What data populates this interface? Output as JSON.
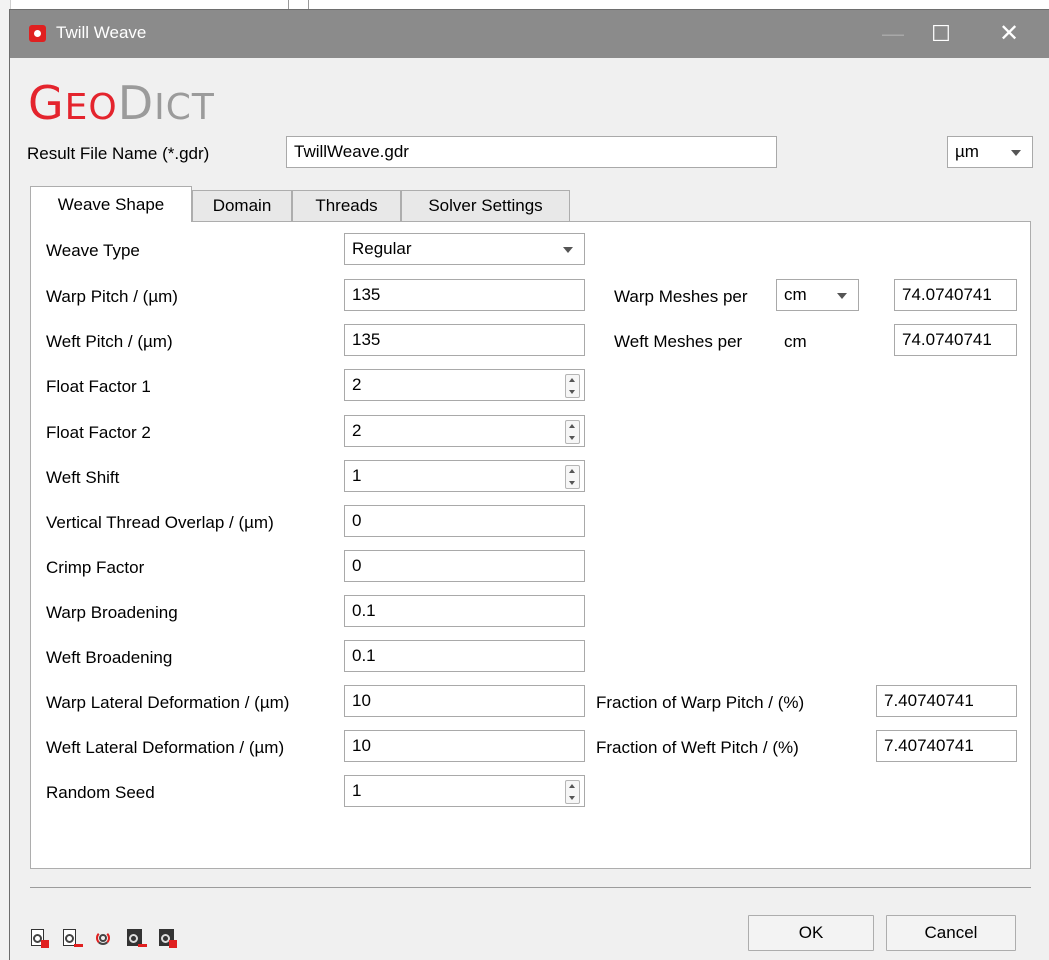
{
  "window": {
    "title": "Twill Weave"
  },
  "logo": {
    "geo_g": "G",
    "geo_rest": "EO",
    "dict_d": "D",
    "dict_rest": "ICT"
  },
  "result_file": {
    "label": "Result File Name (*.gdr)",
    "value": "TwillWeave.gdr"
  },
  "unit_select": {
    "value": "µm"
  },
  "tabs": [
    {
      "label": "Weave Shape",
      "active": true
    },
    {
      "label": "Domain",
      "active": false
    },
    {
      "label": "Threads",
      "active": false
    },
    {
      "label": "Solver Settings",
      "active": false
    }
  ],
  "form": {
    "weave_type": {
      "label": "Weave Type",
      "value": "Regular"
    },
    "warp_pitch": {
      "label": "Warp Pitch / (µm)",
      "value": "135"
    },
    "weft_pitch": {
      "label": "Weft Pitch / (µm)",
      "value": "135"
    },
    "float_factor_1": {
      "label": "Float Factor 1",
      "value": "2"
    },
    "float_factor_2": {
      "label": "Float Factor 2",
      "value": "2"
    },
    "weft_shift": {
      "label": "Weft Shift",
      "value": "1"
    },
    "vertical_overlap": {
      "label": "Vertical Thread Overlap / (µm)",
      "value": "0"
    },
    "crimp_factor": {
      "label": "Crimp Factor",
      "value": "0"
    },
    "warp_broadening": {
      "label": "Warp Broadening",
      "value": "0.1"
    },
    "weft_broadening": {
      "label": "Weft Broadening",
      "value": "0.1"
    },
    "warp_lateral": {
      "label": "Warp Lateral Deformation / (µm)",
      "value": "10"
    },
    "weft_lateral": {
      "label": "Weft Lateral Deformation / (µm)",
      "value": "10"
    },
    "random_seed": {
      "label": "Random Seed",
      "value": "1"
    },
    "warp_meshes": {
      "label": "Warp Meshes per",
      "unit": "cm",
      "value": "74.0740741"
    },
    "weft_meshes": {
      "label": "Weft Meshes per",
      "unit": "cm",
      "value": "74.0740741"
    },
    "frac_warp": {
      "label": "Fraction of Warp Pitch / (%)",
      "value": "7.40740741"
    },
    "frac_weft": {
      "label": "Fraction of Weft Pitch / (%)",
      "value": "7.40740741"
    }
  },
  "buttons": {
    "ok": "OK",
    "cancel": "Cancel"
  },
  "toolbar_icons": [
    "save-gps-icon",
    "load-gps-icon",
    "reset-icon",
    "save-macro-icon",
    "lock-macro-icon"
  ],
  "colors": {
    "brand_red": "#e4242d",
    "titlebar": "#8b8b8b",
    "logo_gray": "#9b9b9b"
  }
}
